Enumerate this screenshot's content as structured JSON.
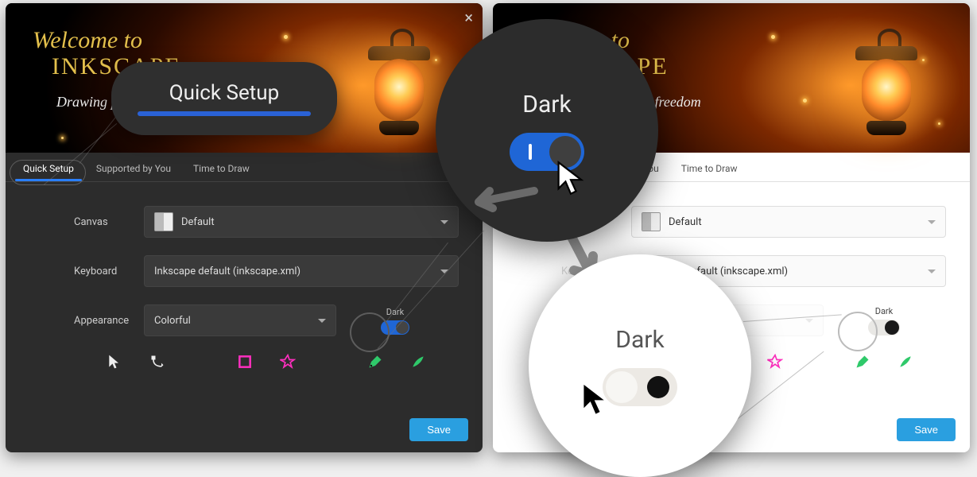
{
  "hero": {
    "title_line1": "Welcome to",
    "title_line2": "INKSCAPE",
    "subtitle": "Drawing people to freedom"
  },
  "tabs": [
    {
      "id": "quick-setup",
      "label": "Quick Setup",
      "active": true
    },
    {
      "id": "supported",
      "label": "Supported by You",
      "active": false
    },
    {
      "id": "draw",
      "label": "Time to Draw",
      "active": false
    }
  ],
  "form": {
    "canvas": {
      "label": "Canvas",
      "value": "Default"
    },
    "keyboard": {
      "label": "Keyboard",
      "value": "Inkscape default (inkscape.xml)"
    },
    "appearance": {
      "label": "Appearance",
      "value": "Colorful"
    },
    "dark_caption": "Dark"
  },
  "buttons": {
    "save": "Save"
  },
  "callouts": {
    "quick_setup": "Quick Setup",
    "dark": "Dark"
  }
}
